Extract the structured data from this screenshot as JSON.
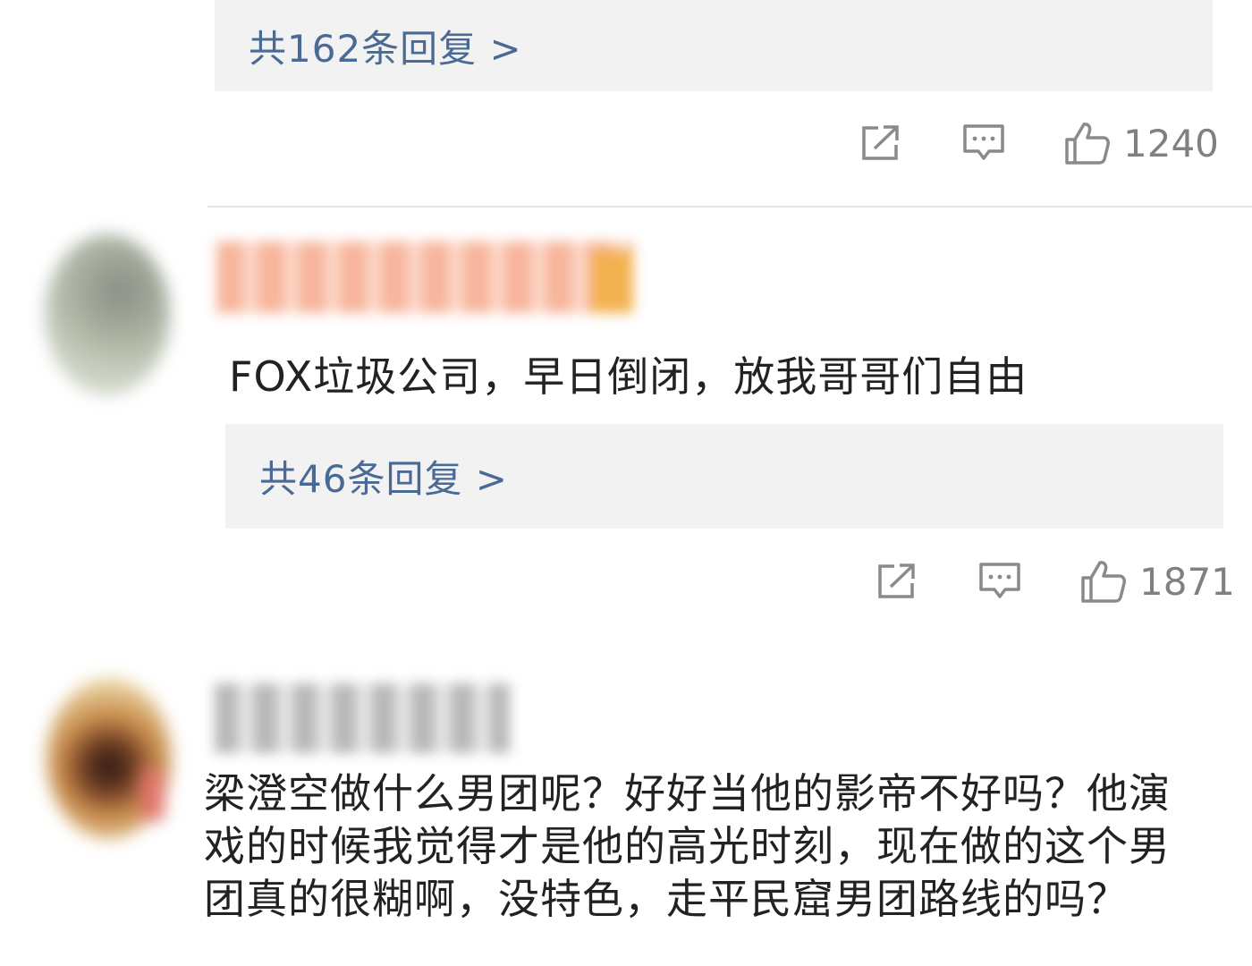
{
  "thread1": {
    "reply_label": "共162条回复 >",
    "like_count": "1240"
  },
  "comment2": {
    "text": "FOX垃圾公司，早日倒闭，放我哥哥们自由",
    "reply_label": "共46条回复 >",
    "like_count": "1871"
  },
  "comment3": {
    "text": "梁澄空做什么男团呢？好好当他的影帝不好吗？他演戏的时候我觉得才是他的高光时刻，现在做的这个男团真的很糊啊，没特色，走平民窟男团路线的吗？"
  },
  "icons": {
    "share": "share-icon",
    "comment": "comment-icon",
    "like": "thumbs-up-icon"
  },
  "colors": {
    "reply_link": "#4a6a96",
    "reply_bg": "#f2f2f2",
    "icon_gray": "#8a8a8a"
  }
}
